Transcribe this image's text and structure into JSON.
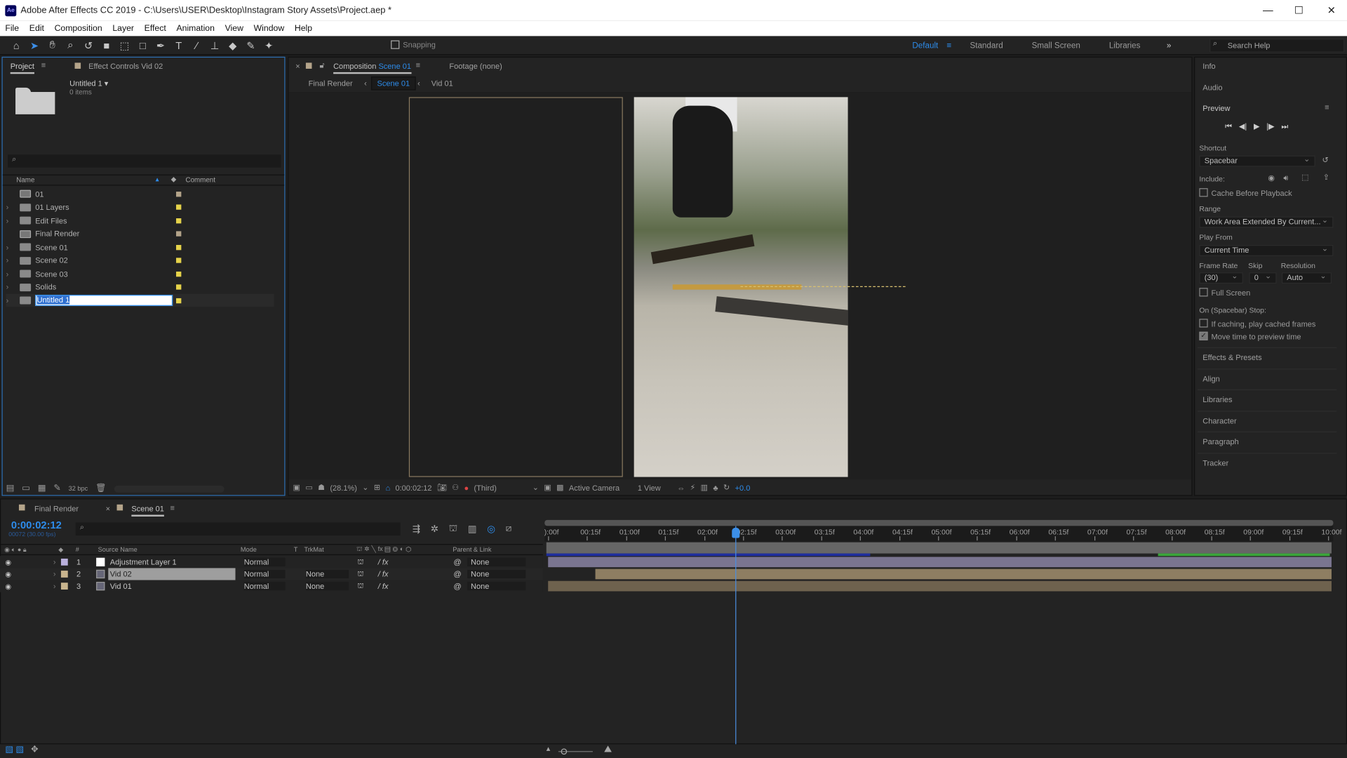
{
  "window": {
    "title": "Adobe After Effects CC 2019 - C:\\Users\\USER\\Desktop\\Instagram Story Assets\\Project.aep *",
    "logo": "Ae",
    "controls": [
      "—",
      "☐",
      "✕"
    ]
  },
  "menu": [
    "File",
    "Edit",
    "Composition",
    "Layer",
    "Effect",
    "Animation",
    "View",
    "Window",
    "Help"
  ],
  "toolbar": {
    "tools": [
      "home-icon",
      "selection-icon",
      "hand-icon",
      "zoom-icon",
      "rotate-icon",
      "camera-icon",
      "pan-behind-icon",
      "rectangle-icon",
      "pen-icon",
      "type-icon",
      "brush-icon",
      "clone-stamp-icon",
      "eraser-icon",
      "roto-brush-icon",
      "puppet-pin-icon"
    ],
    "snapping": "Snapping",
    "workspaces": [
      "Default",
      "Standard",
      "Small Screen",
      "Libraries"
    ],
    "search_placeholder": "Search Help"
  },
  "project": {
    "tab": "Project",
    "effect_controls": "Effect Controls Vid 02",
    "selected_name": "Untitled 1 ▾",
    "selected_info": "0 items",
    "columns": {
      "name": "Name",
      "comment": "Comment"
    },
    "bpc": "32 bpc",
    "items": [
      {
        "name": "01",
        "type": "comp",
        "color": "#b4a48a"
      },
      {
        "name": "01 Layers",
        "type": "folder",
        "color": "#e6d34a"
      },
      {
        "name": "Edit Files",
        "type": "folder",
        "color": "#e6d34a"
      },
      {
        "name": "Final Render",
        "type": "comp",
        "color": "#b4a48a"
      },
      {
        "name": "Scene 01",
        "type": "folder",
        "color": "#e6d34a"
      },
      {
        "name": "Scene 02",
        "type": "folder",
        "color": "#e6d34a"
      },
      {
        "name": "Scene 03",
        "type": "folder",
        "color": "#e6d34a"
      },
      {
        "name": "Solids",
        "type": "folder",
        "color": "#e6d34a"
      },
      {
        "name": "Untitled 1",
        "type": "folder",
        "color": "#e6d34a",
        "editing": true
      }
    ]
  },
  "composition": {
    "tab_prefix": "Composition",
    "tab_name": "Scene 01",
    "footage": "Footage (none)",
    "breadcrumbs": [
      "Final Render",
      "Scene 01",
      "Vid 01"
    ],
    "footer": {
      "zoom": "(28.1%)",
      "time": "0:00:02:12",
      "resolution": "(Third)",
      "camera": "Active Camera",
      "views": "1 View",
      "exposure": "+0.0"
    }
  },
  "right": {
    "info": "Info",
    "audio": "Audio",
    "preview": "Preview",
    "shortcut_label": "Shortcut",
    "shortcut": "Spacebar",
    "include": "Include:",
    "cache_before": "Cache Before Playback",
    "range_label": "Range",
    "range": "Work Area Extended By Current...",
    "play_from_label": "Play From",
    "play_from": "Current Time",
    "frame_rate_label": "Frame Rate",
    "skip_label": "Skip",
    "resolution_label": "Resolution",
    "frame_rate": "(30)",
    "skip": "0",
    "resolution": "Auto",
    "full_screen": "Full Screen",
    "on_stop": "On (Spacebar) Stop:",
    "if_caching": "If caching, play cached frames",
    "move_time": "Move time to preview time",
    "move_time_checked": true,
    "panels": [
      "Effects & Presets",
      "Align",
      "Libraries",
      "Character",
      "Paragraph",
      "Tracker"
    ]
  },
  "timeline": {
    "tabs": [
      "Final Render",
      "Scene 01"
    ],
    "timecode": "0:00:02:12",
    "frames": "00072 (30.00 fps)",
    "headers": {
      "num": "#",
      "source": "Source Name",
      "mode": "Mode",
      "t": "T",
      "trkmat": "TrkMat",
      "parent": "Parent & Link"
    },
    "layers": [
      {
        "num": "1",
        "name": "Adjustment Layer 1",
        "mode": "Normal",
        "trkmat": "",
        "parent": "None",
        "color": "#b9b0dc",
        "bar": "#7a7590",
        "start": 0
      },
      {
        "num": "2",
        "name": "Vid 02",
        "mode": "Normal",
        "trkmat": "None",
        "parent": "None",
        "color": "#c8b48e",
        "bar": "#8e7e62",
        "start": 0.6,
        "selected": true
      },
      {
        "num": "3",
        "name": "Vid 01",
        "mode": "Normal",
        "trkmat": "None",
        "parent": "None",
        "color": "#c8b48e",
        "bar": "#6e624e",
        "start": 0
      }
    ],
    "ruler": [
      "):00f",
      "00:15f",
      "01:00f",
      "01:15f",
      "02:00f",
      "02:15f",
      "03:00f",
      "03:15f",
      "04:00f",
      "04:15f",
      "05:00f",
      "05:15f",
      "06:00f",
      "06:15f",
      "07:00f",
      "07:15f",
      "08:00f",
      "08:15f",
      "09:00f",
      "09:15f",
      "10:00f"
    ],
    "duration_seconds": 10,
    "current_seconds": 2.4
  }
}
